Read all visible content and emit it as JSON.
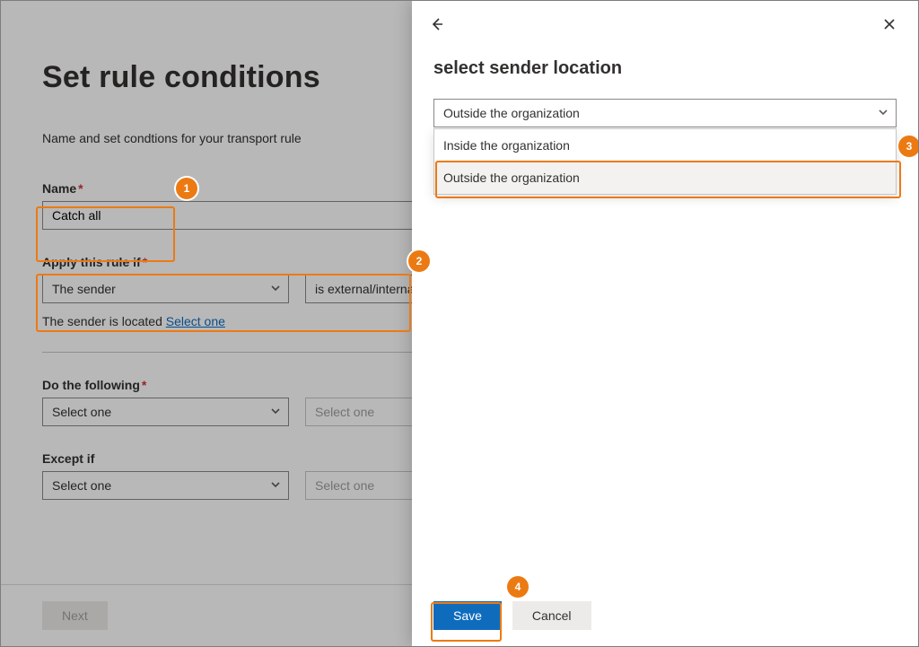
{
  "main": {
    "heading": "Set rule conditions",
    "subtitle": "Name and set condtions for your transport rule",
    "name_label": "Name",
    "name_value": "Catch all",
    "apply_label": "Apply this rule if",
    "apply_select1": "The sender",
    "apply_select2": "is external/internal",
    "hint_prefix": "The sender is located ",
    "hint_link": "Select one",
    "do_label": "Do the following",
    "do_select1": "Select one",
    "do_select2_placeholder": "Select one",
    "except_label": "Except if",
    "except_select1": "Select one",
    "except_select2_placeholder": "Select one",
    "next_button": "Next"
  },
  "panel": {
    "title": "select sender location",
    "selected_value": "Outside the organization",
    "options": {
      "0": "Inside the organization",
      "1": "Outside the organization"
    },
    "save": "Save",
    "cancel": "Cancel"
  },
  "badges": {
    "b1": "1",
    "b2": "2",
    "b3": "3",
    "b4": "4"
  },
  "colors": {
    "accent": "#0f6cbd",
    "callout": "#EC7A13"
  }
}
